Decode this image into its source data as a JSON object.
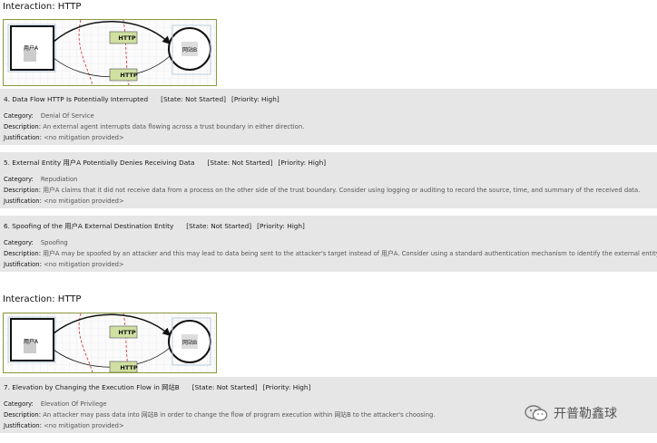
{
  "section1": {
    "title": "Interaction: HTTP"
  },
  "section2": {
    "title": "Interaction: HTTP"
  },
  "diagram": {
    "entity_a": "用户A",
    "process_b": "网站B",
    "flow_top": "HTTP",
    "flow_bottom": "HTTP"
  },
  "threats": [
    {
      "title": "4. Data Flow HTTP Is Potentially Interrupted",
      "state": "[State: Not Started]",
      "priority": "[Priority: High]",
      "category_label": "Category:",
      "category": "Denial Of Service",
      "description_label": "Description:",
      "description": "An external agent interrupts data flowing across a trust boundary in either direction.",
      "justification_label": "Justification:",
      "justification": "<no mitigation provided>"
    },
    {
      "title": "5. External Entity 用户A Potentially Denies Receiving Data",
      "state": "[State: Not Started]",
      "priority": "[Priority: High]",
      "category_label": "Category:",
      "category": "Repudiation",
      "description_label": "Description:",
      "description": "用户A claims that it did not receive data from a process on the other side of the trust boundary. Consider using logging or auditing to record the source, time, and summary of the received data.",
      "justification_label": "Justification:",
      "justification": "<no mitigation provided>"
    },
    {
      "title": "6. Spoofing of the 用户A External Destination Entity",
      "state": "[State: Not Started]",
      "priority": "[Priority: High]",
      "category_label": "Category:",
      "category": "Spoofing",
      "description_label": "Description:",
      "description": "用户A may be spoofed by an attacker and this may lead to data being sent to the attacker's target instead of 用户A. Consider using a standard authentication mechanism to identify the external entity.",
      "justification_label": "Justification:",
      "justification": "<no mitigation provided>"
    },
    {
      "title": "7. Elevation by Changing the Execution Flow in 网站B",
      "state": "[State: Not Started]",
      "priority": "[Priority: High]",
      "category_label": "Category:",
      "category": "Elevation Of Privilege",
      "description_label": "Description:",
      "description": "An attacker may pass data into 网站B in order to change the flow of program execution within 网站B to the attacker's choosing.",
      "justification_label": "Justification:",
      "justification": "<no mitigation provided>"
    }
  ],
  "watermark": {
    "text": "开普勒鑫球"
  }
}
